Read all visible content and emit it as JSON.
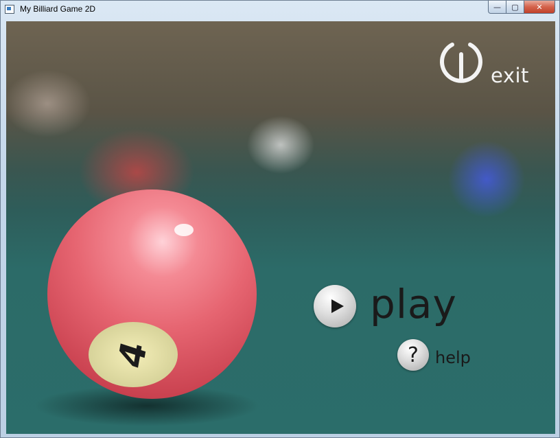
{
  "window": {
    "title": "My Billiard Game 2D",
    "minimize_glyph": "—",
    "maximize_glyph": "▢",
    "close_glyph": "✕"
  },
  "scene": {
    "ball_number": "4",
    "ball_color": "#e66571",
    "felt_color": "#2b6d6a"
  },
  "menu": {
    "exit_label": "exit",
    "exit_icon": "power-icon",
    "play_label": "play",
    "play_icon": "play-icon",
    "help_label": "help",
    "help_icon": "question-icon",
    "help_glyph": "?"
  }
}
